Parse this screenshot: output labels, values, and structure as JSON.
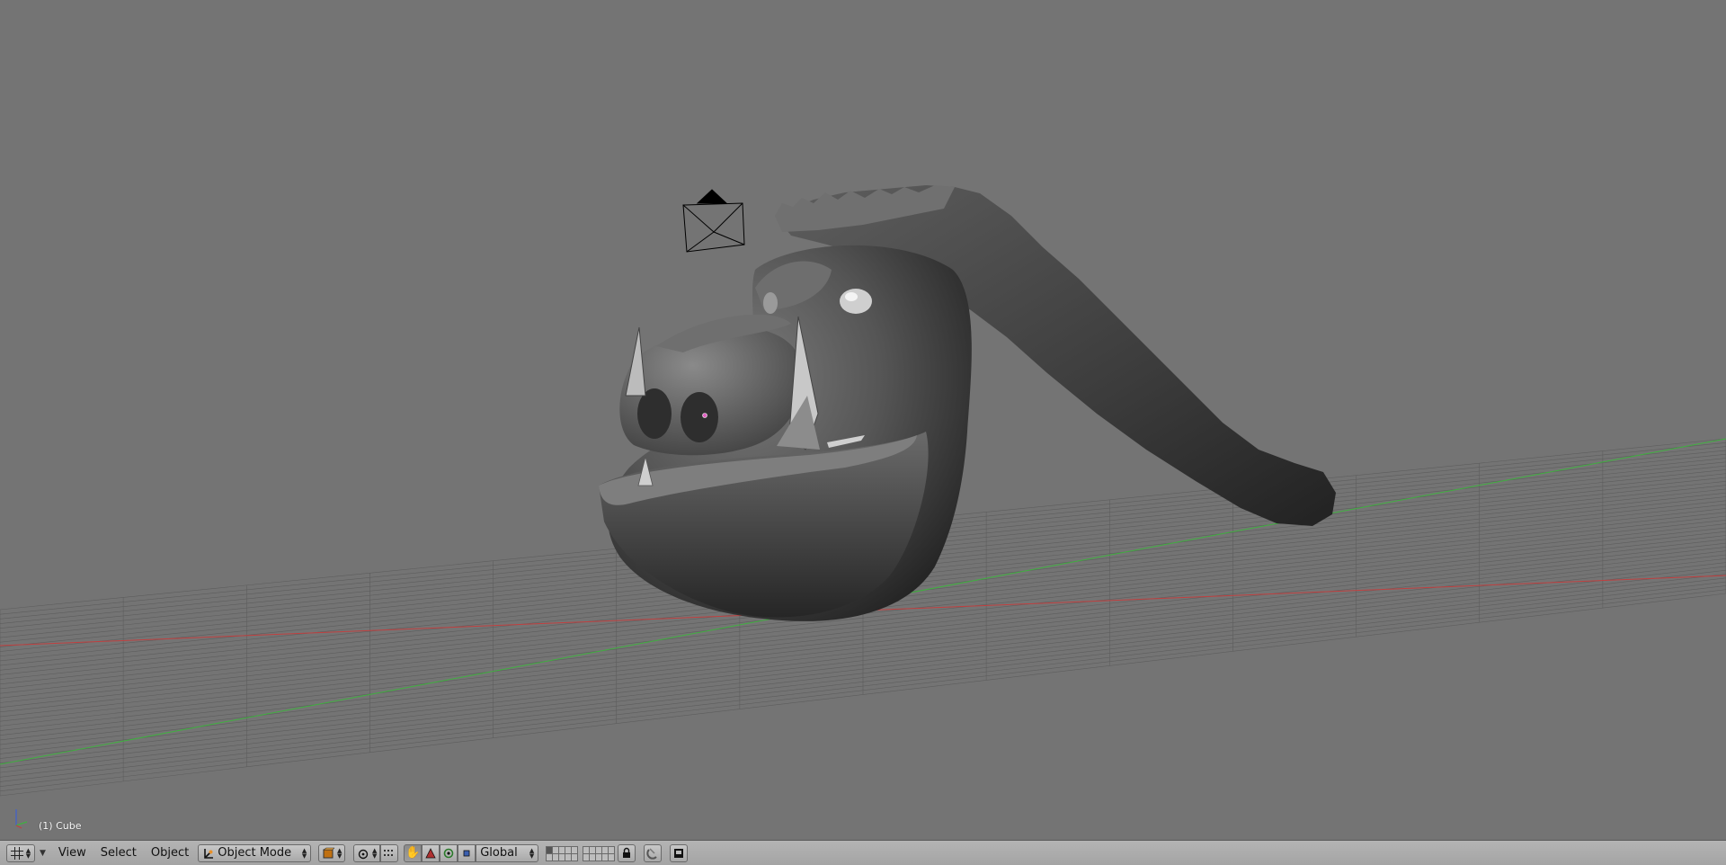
{
  "viewport": {
    "object_label": "(1) Cube",
    "background_color": "#747474",
    "axis_x_color": "#c04040",
    "axis_y_color": "#40b040",
    "axis_z_color": "#4060d0"
  },
  "header": {
    "editor_type_icon": "grid-icon",
    "menus": {
      "view": "View",
      "select": "Select",
      "object": "Object"
    },
    "mode": {
      "icon": "object-mode-icon",
      "label": "Object Mode"
    },
    "shading_icon": "solid-shading-icon",
    "pivot_icon": "pivot-point-icon",
    "manipulator_icons": [
      "hand-manipulator-icon",
      "translate-icon",
      "rotate-icon",
      "scale-icon"
    ],
    "orientation": "Global",
    "lock_icon": "lock-icon",
    "snap_icon": "snap-magnet-icon",
    "render_icon": "render-preview-icon"
  }
}
